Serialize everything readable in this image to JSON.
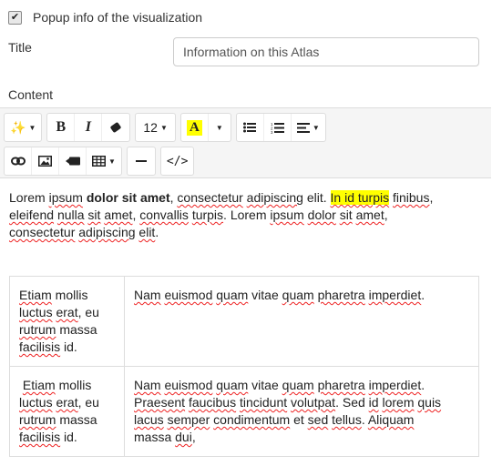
{
  "popup_checkbox": {
    "label": "Popup info of the visualization",
    "checked": true
  },
  "title": {
    "label": "Title",
    "value": "Information on this Atlas"
  },
  "content_label": "Content",
  "toolbar": {
    "row1": [
      {
        "name": "magic-wand-button",
        "icon": "magic-wand-icon",
        "glyph": "✨",
        "caret": true
      },
      {
        "name": "bold-button",
        "icon": "bold-icon",
        "glyph": "B"
      },
      {
        "name": "italic-button",
        "icon": "italic-icon",
        "glyph": "I"
      },
      {
        "name": "eraser-button",
        "icon": "eraser-icon",
        "glyph": "⌫"
      },
      {
        "name": "font-size-dropdown",
        "text": "12",
        "caret": true
      },
      {
        "name": "text-color-button",
        "icon": "highlight-a-icon",
        "glyph": "A"
      },
      {
        "name": "color-dropdown",
        "caret": true
      },
      {
        "name": "unordered-list-button",
        "icon": "bullet-list-icon",
        "glyph": "☰"
      },
      {
        "name": "ordered-list-button",
        "icon": "numbered-list-icon",
        "glyph": "☷"
      },
      {
        "name": "align-dropdown",
        "icon": "align-left-icon",
        "glyph": "≡",
        "caret": true
      }
    ],
    "row2": [
      {
        "name": "link-button",
        "icon": "link-icon",
        "glyph": "🔗"
      },
      {
        "name": "image-button",
        "icon": "image-icon",
        "glyph": "▣"
      },
      {
        "name": "video-button",
        "icon": "video-icon",
        "glyph": "▶"
      },
      {
        "name": "table-dropdown",
        "icon": "table-icon",
        "glyph": "⊞",
        "caret": true
      },
      {
        "name": "hr-button",
        "icon": "horizontal-rule-icon",
        "glyph": "—"
      },
      {
        "name": "code-view-button",
        "icon": "code-icon",
        "glyph": "</>"
      }
    ],
    "font_size": "12"
  },
  "editor": {
    "p_1": "Lorem ",
    "p_2": "ipsum",
    "p_3": "dolor sit amet",
    "p_4": ", ",
    "p_5": "consectetur",
    "p_6": " ",
    "p_7": "adipiscing",
    "p_8": " elit. ",
    "p_9": "In id turpis",
    "p_10": " ",
    "p_11": "finibus",
    "p_12": ",",
    "p_13": "eleifend",
    "p_14": "nulla",
    "p_15": "sit",
    "p_16": "amet",
    "p_17": ", ",
    "p_18": "convallis",
    "p_19": "turpis",
    "p_20": ". Lorem ",
    "p_21": "ipsum",
    "p_22": "dolor",
    "p_23": "sit",
    "p_24": "amet",
    "p_25": ",",
    "p_26": "consectetur",
    "p_27": "adipiscing",
    "p_28": "elit",
    "p_29": "."
  },
  "table": {
    "r1c1": {
      "a": "Etiam",
      "b": " mollis ",
      "c": "luctus",
      "d": " ",
      "e": "erat",
      "f": ", eu ",
      "g": "rutrum",
      "h": " massa ",
      "i": "facilisis",
      "j": " id."
    },
    "r1c2": {
      "a": "Nam",
      "b": "euismod",
      "c": "quam",
      "d": " vitae ",
      "e": "quam",
      "f": "pharetra",
      "g": "imperdiet",
      "h": "."
    },
    "r2c1": {
      "a": "Etiam",
      "b": " mollis ",
      "c": "luctus",
      "d": " ",
      "e": "erat",
      "f": ", eu ",
      "g": "rutrum",
      "h": " massa ",
      "i": "facilisis",
      "j": " id."
    },
    "r2c2": {
      "a": "Nam",
      "b": "euismod",
      "c": "quam",
      "d": " vitae ",
      "e": "quam",
      "f": "pharetra",
      "g": "imperdiet",
      "h": ".",
      "i": "Praesent",
      "j": "faucibus",
      "k": "tincidunt",
      "l": "volutpat",
      ". Sed": "",
      "m": ". Sed ",
      "n": "id",
      "o": "lorem",
      "p": "quis",
      "q": "lacus",
      "r": "semper",
      "s": "condimentum",
      "t": " et ",
      "u": "sed",
      "v": "tellus",
      "w": ". ",
      "x": "Aliquam",
      "y": "massa",
      "z": "dui",
      "end": ","
    }
  }
}
